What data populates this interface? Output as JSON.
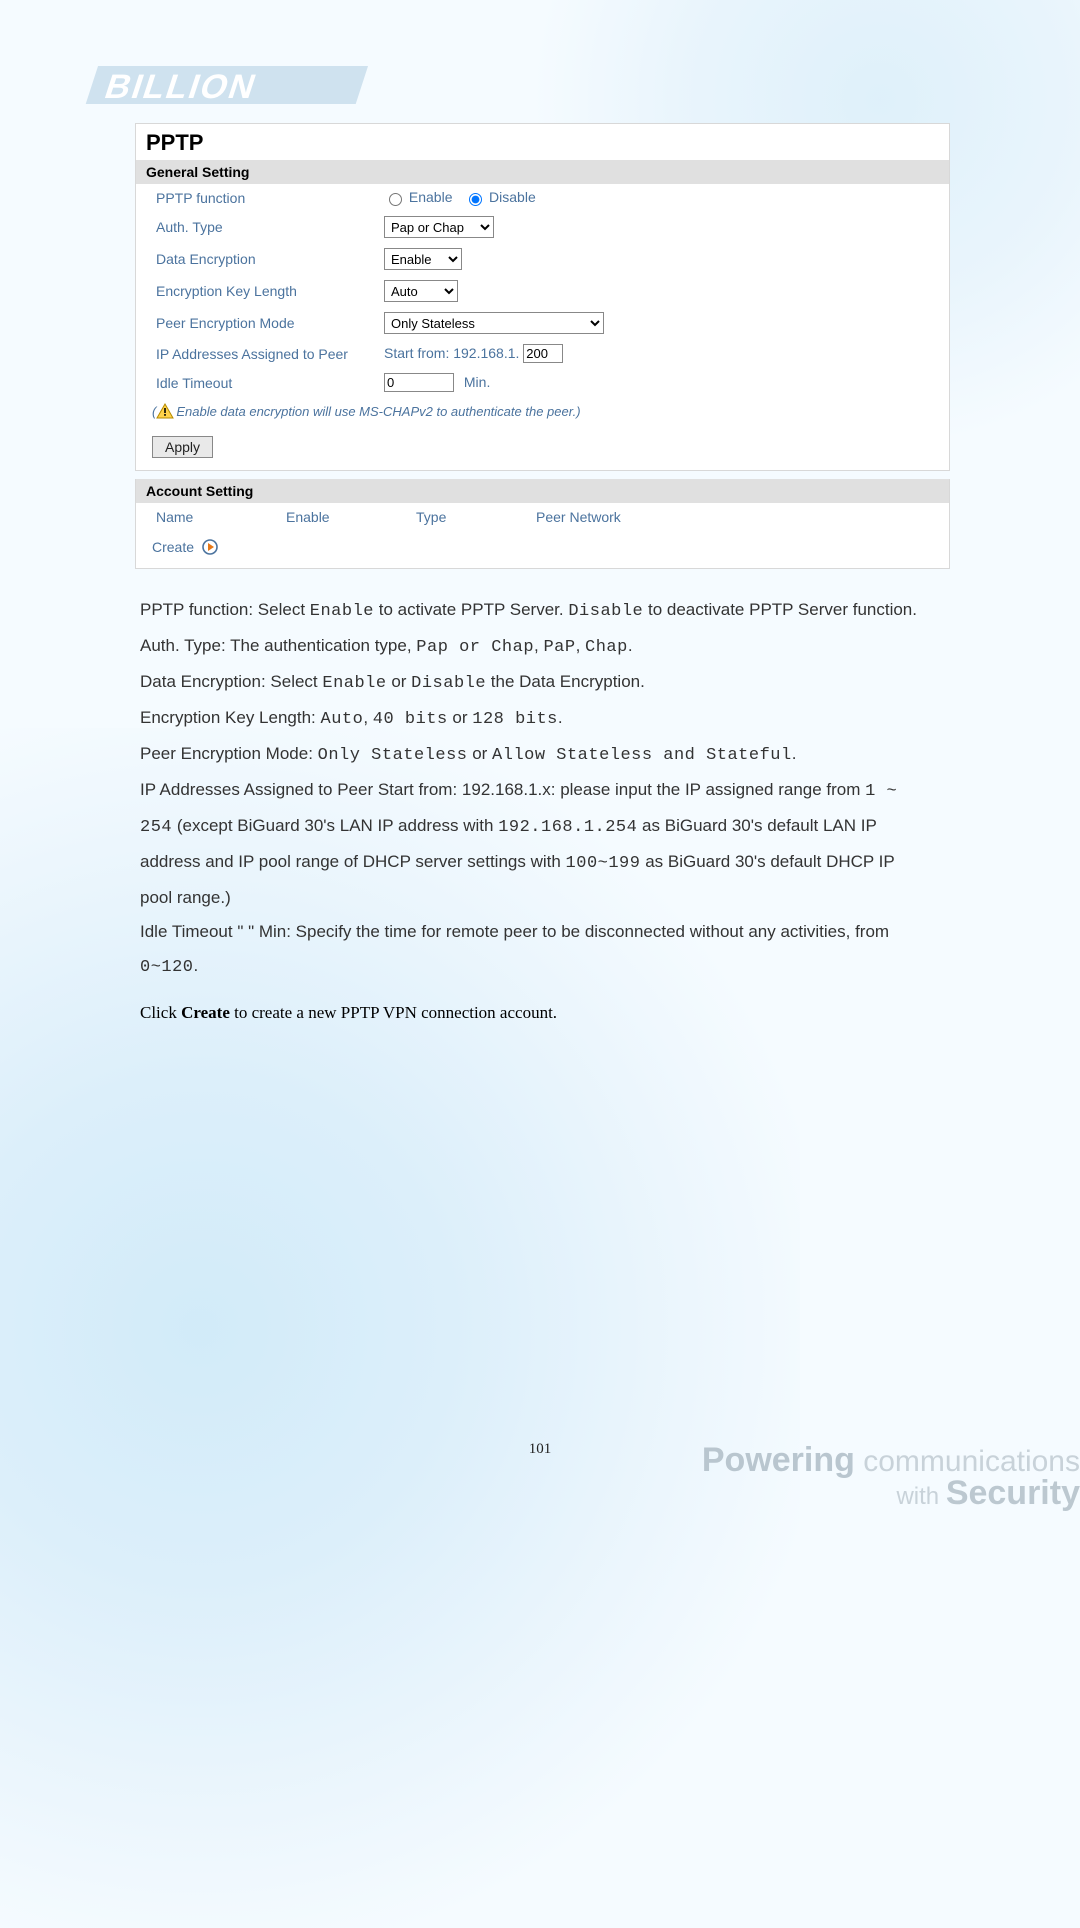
{
  "panel": {
    "title": "PPTP",
    "general": {
      "header": "General Setting",
      "pptp_function_label": "PPTP function",
      "enable_label": "Enable",
      "disable_label": "Disable",
      "pptp_selected": "disable",
      "auth_type_label": "Auth. Type",
      "auth_type_value": "Pap or Chap",
      "data_encryption_label": "Data Encryption",
      "data_encryption_value": "Enable",
      "enc_key_len_label": "Encryption Key Length",
      "enc_key_len_value": "Auto",
      "peer_enc_mode_label": "Peer Encryption Mode",
      "peer_enc_mode_value": "Only Stateless",
      "ip_assigned_label": "IP Addresses Assigned to Peer",
      "ip_assigned_prefix": "Start from: 192.168.1.",
      "ip_assigned_value": "200",
      "idle_timeout_label": "Idle Timeout",
      "idle_timeout_value": "0",
      "idle_timeout_unit": "Min.",
      "warning_text": "Enable data encryption will use MS-CHAPv2 to authenticate the peer.",
      "apply_label": "Apply"
    },
    "account": {
      "header": "Account Setting",
      "col_name": "Name",
      "col_enable": "Enable",
      "col_type": "Type",
      "col_peer": "Peer Network",
      "create_label": "Create"
    }
  },
  "desc": {
    "p1a": "PPTP function: Select ",
    "p1b": "Enable",
    "p1c": " to activate PPTP Server. ",
    "p1d": "Disable",
    "p1e": " to deactivate PPTP Server function.",
    "p2a": "Auth. Type: The authentication type, ",
    "p2b": "Pap or Chap",
    "p2c": ", ",
    "p2d": "PaP",
    "p2e": ", ",
    "p2f": "Chap",
    "p2g": ".",
    "p3a": "Data Encryption: Select ",
    "p3b": "Enable",
    "p3c": " or ",
    "p3d": "Disable",
    "p3e": " the Data Encryption.",
    "p4a": "Encryption Key Length: ",
    "p4b": "Auto",
    "p4c": ", ",
    "p4d": "40 bits",
    "p4e": " or ",
    "p4f": "128 bits",
    "p4g": ".",
    "p5a": "Peer Encryption Mode: ",
    "p5b": "Only Stateless",
    "p5c": " or ",
    "p5d": "Allow Stateless and Stateful",
    "p5e": ".",
    "p6a": "IP Addresses Assigned to Peer Start from: 192.168.1.x: please input the IP assigned range from ",
    "p6b": "1 ~ 254",
    "p6c": " (except BiGuard 30's LAN IP address with ",
    "p6d": "192.168.1.254",
    "p6e": " as BiGuard 30's default LAN IP address and IP pool range of DHCP server settings with ",
    "p6f": "100~199",
    "p6g": " as BiGuard 30's default DHCP IP pool range.)",
    "p7a": "Idle Timeout \"   \" Min: Specify the time for remote peer to be disconnected without any activities, from ",
    "p7b": "0~120",
    "p7c": "."
  },
  "final": {
    "a": "Click ",
    "b": "Create",
    "c": " to create a new PPTP VPN connection account."
  },
  "page_number": "101",
  "footer": {
    "powering": "Powering",
    "communications": " communications",
    "with": "with ",
    "security": "Security"
  }
}
